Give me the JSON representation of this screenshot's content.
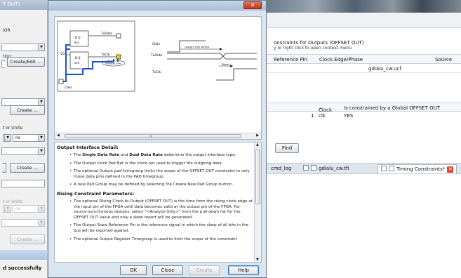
{
  "left_panel": {
    "title": "T OUT)",
    "labels": [
      "IOR",
      "tion:",
      "t or Units:",
      "t or Units:"
    ],
    "create_edit": "Create/Edit ...",
    "create": "Create ...",
    "units_value": "ns",
    "status": "d successfully"
  },
  "dialog": {
    "close_glyph": "✕",
    "diagram": {
      "clkin": "ClkIn",
      "txdata": "TxData",
      "txclk": "TxClk",
      "reg": "REG",
      "vcc": "VCC",
      "ref_pin": "REFERENCE PIN",
      "offset_label": "OFFSET OUT AFTER",
      "skew_label": "Skew",
      "scroll_grip": "III"
    },
    "help": {
      "section1_title": "Output Interface Detail:",
      "s1_item1_pre": "The ",
      "s1_item1_b1": "Single Data Rate",
      "s1_item1_mid": " and ",
      "s1_item1_b2": "Dual Data Rate",
      "s1_item1_post": " determine the output interface type.",
      "s1_item2": "The Output clock Pad Net is the clock net used to trigger the outgoing data.",
      "s1_item3": "The optional Output pad timegroup limits the scope of the OFFSET OUT constraint to only those data pins defined in the PAD timegroup.",
      "s1_item4": "A new Pad Group may be defined by selecting the Create New Pad Group button.",
      "section2_title": "Rising Constraint Parameters:",
      "s2_item1": "The optional Rising Clock-to-Output (OFFSET OUT) is the time from the rising clock edge at the input pin of the FPGA until data becomes valid at the output pin of the FPGA. For source-synchronous designs, select \"<Analyze Only>\" from the pull-down list for the OFFSET OUT value and only a skew report will be generated.",
      "s2_item2": "The Output Skew Reference Pin is the reference signal in which the skew of all bits in the bus will be reported against.",
      "s2_item3": "The optional Output Register Timegroup is used to limit the scope of the constraint"
    },
    "buttons": {
      "ok": "OK",
      "close": "Close",
      "create": "Create",
      "help": "Help"
    }
  },
  "background": {
    "offset_title": "onstraints for Outputs (OFFSET OUT)",
    "offset_sub": "y or right click to open context menu",
    "offset_columns": [
      "Reference Pin",
      "Clock Edge/Phase",
      "Source"
    ],
    "offset_source_value": "gdialu_cw.ucf",
    "global_columns": [
      "Clock",
      "Is constrained by a Global OFFSET OUT"
    ],
    "clock_sort": "^",
    "global_rows": [
      {
        "num": "1",
        "clock": "clk",
        "value": "YES"
      }
    ],
    "find_button": "Find",
    "tabs": [
      "cmd_log",
      "gdialu_cw.tfi",
      "Timing Constraints*"
    ],
    "tab_close": "✕"
  }
}
